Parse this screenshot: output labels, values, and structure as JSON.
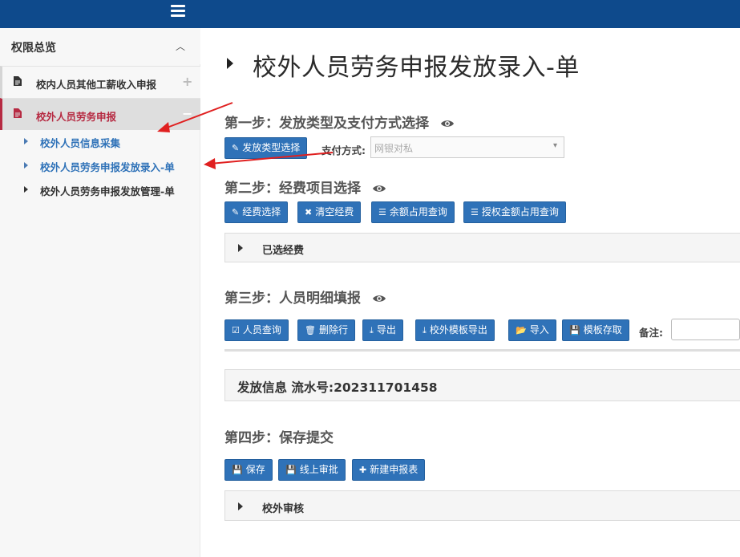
{
  "topbar": {
    "menu_icon": "hamburger-icon"
  },
  "sidebar": {
    "title": "权限总览",
    "title_icon": "chevron-up-icon",
    "items": [
      {
        "label": "校内人员其他工薪收入申报",
        "icon": "file-icon",
        "toggle": "+"
      },
      {
        "label": "校外人员劳务申报",
        "icon": "file-icon",
        "toggle": "−"
      }
    ],
    "subitems": [
      {
        "label": "校外人员信息采集"
      },
      {
        "label": "校外人员劳务申报发放录入-单"
      },
      {
        "label": "校外人员劳务申报发放管理-单"
      }
    ]
  },
  "page": {
    "title": "校外人员劳务申报发放录入-单"
  },
  "step1": {
    "title": "第一步：发放类型及支付方式选择",
    "btn_type": "发放类型选择",
    "pay_label": "支付方式:",
    "pay_value": "网银对私"
  },
  "step2": {
    "title": "第二步：经费项目选择",
    "buttons": [
      "经费选择",
      "清空经费",
      "余额占用查询",
      "授权金额占用查询"
    ],
    "panel_label": "已选经费"
  },
  "step3": {
    "title": "第三步：人员明细填报",
    "buttons": [
      "人员查询",
      "删除行",
      "导出",
      "校外模板导出",
      "导入",
      "模板存取"
    ],
    "remark_label": "备注:"
  },
  "issue": {
    "label": "发放信息 流水号:202311701458"
  },
  "step4": {
    "title": "第四步：保存提交",
    "buttons": [
      "保存",
      "线上审批",
      "新建申报表"
    ],
    "panel_label": "校外审核"
  },
  "colors": {
    "topbar": "#0e4a8c",
    "button": "#2f72b8",
    "active": "#b62a42",
    "annotation": "#e02020"
  }
}
